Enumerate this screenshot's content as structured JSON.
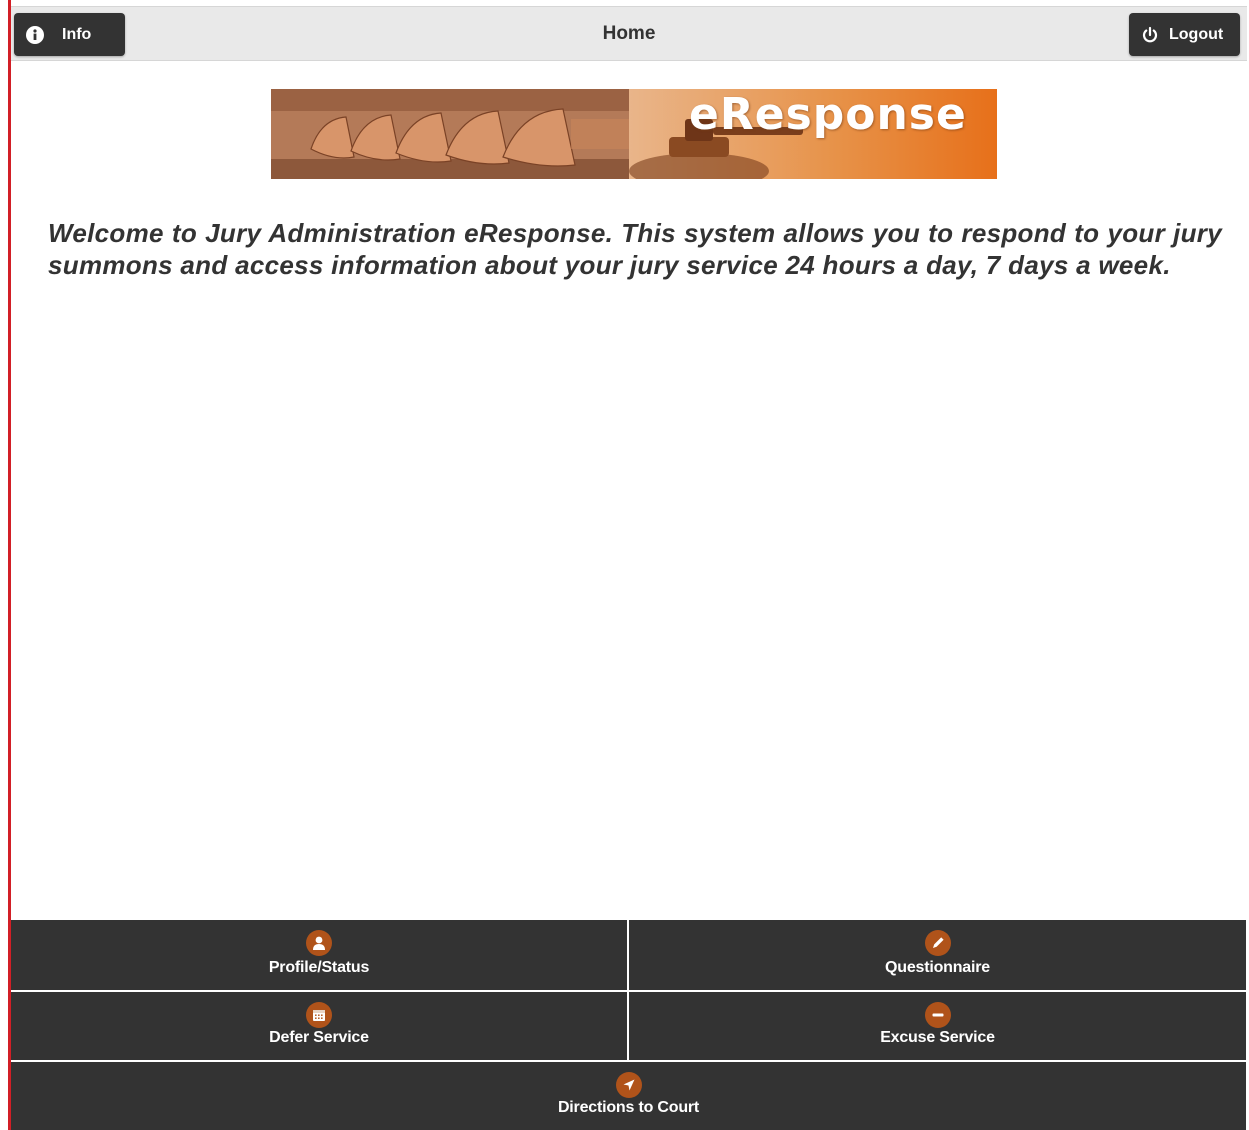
{
  "header": {
    "title": "Home",
    "info_label": "Info",
    "logout_label": "Logout"
  },
  "banner": {
    "title": "eResponse"
  },
  "main": {
    "welcome_text": "Welcome to Jury Administration eResponse. This system allows you to respond to your jury summons and access information about your jury service 24 hours a day, 7 days a week."
  },
  "nav": {
    "items": [
      {
        "label": "Profile/Status",
        "icon": "user-icon"
      },
      {
        "label": "Questionnaire",
        "icon": "pencil-icon"
      },
      {
        "label": "Defer Service",
        "icon": "calendar-icon"
      },
      {
        "label": "Excuse Service",
        "icon": "minus-icon"
      },
      {
        "label": "Directions to Court",
        "icon": "navigation-arrow-icon"
      }
    ]
  },
  "colors": {
    "accent": "#b0531a",
    "left_border": "#d21f26",
    "button_bg": "#333333",
    "header_bg": "#e9e9e9"
  }
}
